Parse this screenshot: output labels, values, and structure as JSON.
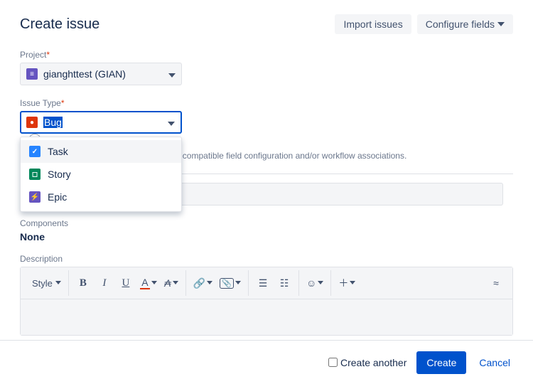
{
  "header": {
    "title": "Create issue",
    "importBtn": "Import issues",
    "configureBtn": "Configure fields"
  },
  "fields": {
    "project": {
      "label": "Project",
      "value": "gianghttest (GIAN)",
      "iconGlyph": "≡"
    },
    "issueType": {
      "label": "Issue Type",
      "value": "Bug",
      "hint": "Some issue types are unavailable due to incompatible field configuration and/or workflow associations.",
      "options": [
        {
          "label": "Task",
          "iconClass": "blue",
          "glyph": "✓"
        },
        {
          "label": "Story",
          "iconClass": "green",
          "glyph": "◻"
        },
        {
          "label": "Epic",
          "iconClass": "violet",
          "glyph": "⚡"
        }
      ]
    },
    "components": {
      "label": "Components",
      "value": "None"
    },
    "description": {
      "label": "Description",
      "toolbar": {
        "style": "Style",
        "bold": "B",
        "italic": "I",
        "underline": "U",
        "textColorA": "A",
        "clearFmt": "₳",
        "link": "🔗",
        "attach": "📎",
        "ul": "•≡",
        "ol": "1≡",
        "emoji": "☺",
        "more": "＋",
        "expand": "»"
      }
    }
  },
  "footer": {
    "createAnother": "Create another",
    "create": "Create",
    "cancel": "Cancel"
  }
}
